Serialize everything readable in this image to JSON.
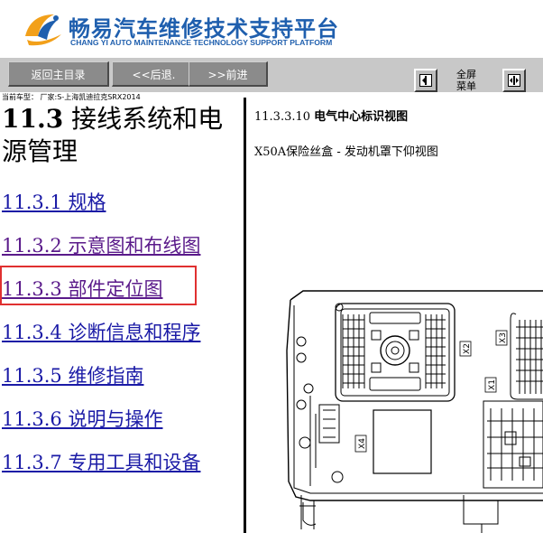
{
  "header": {
    "title": "畅易汽车维修技术支持平台",
    "subtitle": "CHANG YI AUTO MAINTENANCE TECHNOLOGY SUPPORT PLATFORM"
  },
  "toolbar": {
    "home_label": "返回主目录",
    "back_label": "<<后退.",
    "forward_label": ">>前进",
    "menu_label_line1": "全屏",
    "menu_label_line2": "菜单"
  },
  "car_model": "当前车型： 厂家:S-上海凯迪拉克SRX2014",
  "left": {
    "section_number": "11.3",
    "section_title": " 接线系统和电源管理",
    "toc": [
      {
        "label": "11.3.1 规格"
      },
      {
        "label": "11.3.2 示意图和布线图"
      },
      {
        "label": "11.3.3 部件定位图"
      },
      {
        "label": "11.3.4 诊断信息和程序"
      },
      {
        "label": "11.3.5 维修指南"
      },
      {
        "label": "11.3.6 说明与操作"
      },
      {
        "label": "11.3.7 专用工具和设备"
      }
    ]
  },
  "right": {
    "heading_number": "11.3.3.10",
    "heading_title": "电气中心标识视图",
    "caption": "X50A保险丝盒 - 发动机罩下仰视图",
    "connector_labels": [
      "X2",
      "X3",
      "X1",
      "X4"
    ]
  },
  "colors": {
    "brand_blue": "#1f5fae",
    "toolbar_gray": "#c8c8c8",
    "link_blue": "#1a1aa6",
    "highlight_red": "#e03030"
  }
}
